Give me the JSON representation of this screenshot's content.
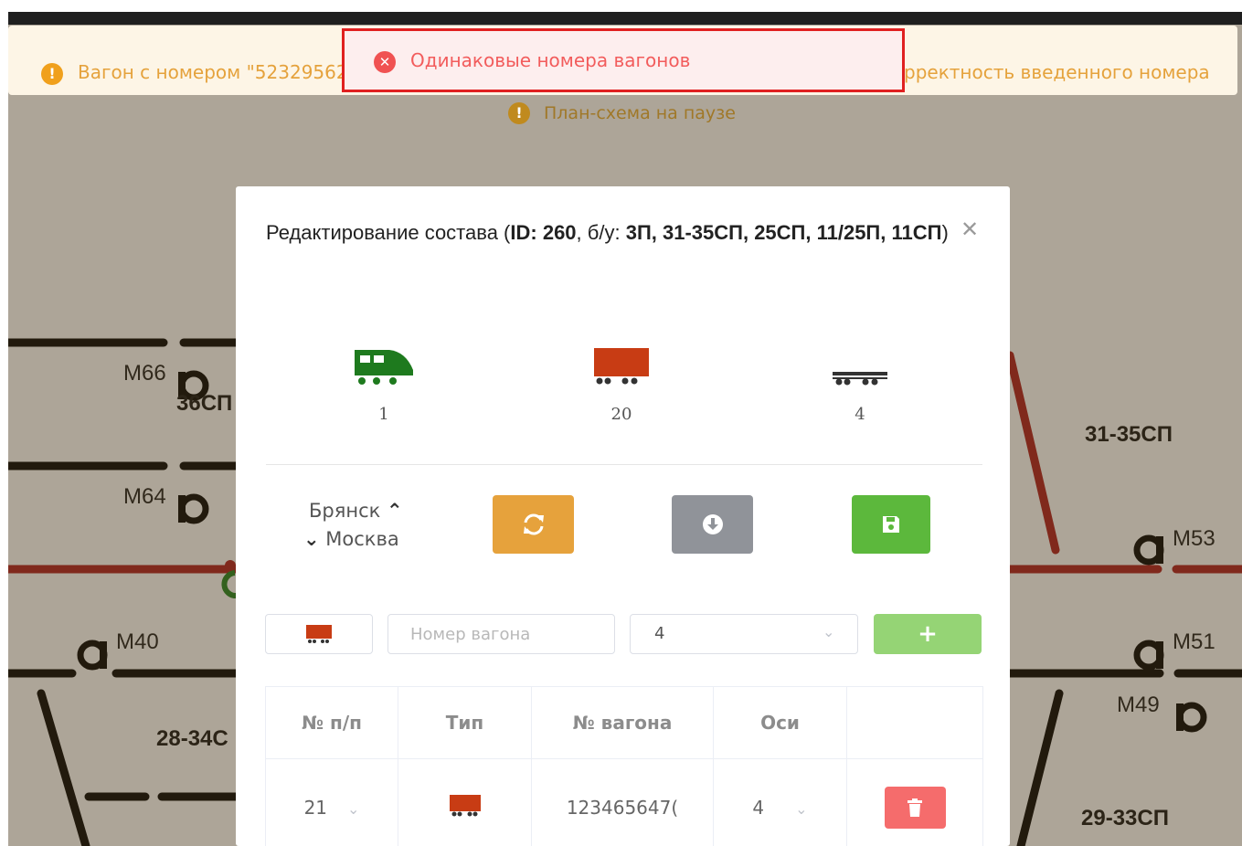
{
  "notifications": {
    "left_warning": "Вагон с номером \"52329562",
    "right_warning": "рректность введенного номера",
    "error": "Одинаковые номера вагонов",
    "pause": "План-схема на паузе"
  },
  "scheme": {
    "track_labels": [
      "36СП",
      "31-35СП",
      "28-34С",
      "29-33СП"
    ],
    "signals": [
      "М66",
      "М64",
      "М53",
      "М40",
      "М51",
      "М49"
    ]
  },
  "modal": {
    "title_prefix": "Редактирование состава (",
    "id_label": "ID:",
    "id_value": "260",
    "bu_label": "б/у:",
    "bu_value": "3П, 31-35СП, 25СП, 11/25П, 11СП",
    "title_suffix": ")",
    "stats": [
      {
        "icon": "locomotive-icon",
        "count": "1",
        "color": "#1e7a1e"
      },
      {
        "icon": "boxcar-icon",
        "count": "20",
        "color": "#c83c14"
      },
      {
        "icon": "flatcar-icon",
        "count": "4",
        "color": "#333333"
      }
    ],
    "direction_from": "Брянск",
    "direction_to": "Москва",
    "add_row": {
      "wagon_number_placeholder": "Номер вагона",
      "axes_value": "4",
      "add_label": "+"
    },
    "table": {
      "headers": [
        "№ п/п",
        "Тип",
        "№ вагона",
        "Оси",
        ""
      ],
      "rows": [
        {
          "index": "21",
          "wagon_number": "123465647(",
          "axes": "4"
        }
      ]
    }
  },
  "colors": {
    "warning": "#e5a23c",
    "error": "#f25c5c",
    "refresh_button": "#e6a23c",
    "download_button": "#909399",
    "save_button": "#5cb83c",
    "add_button": "#95d475",
    "delete_button": "#f56c6c"
  }
}
